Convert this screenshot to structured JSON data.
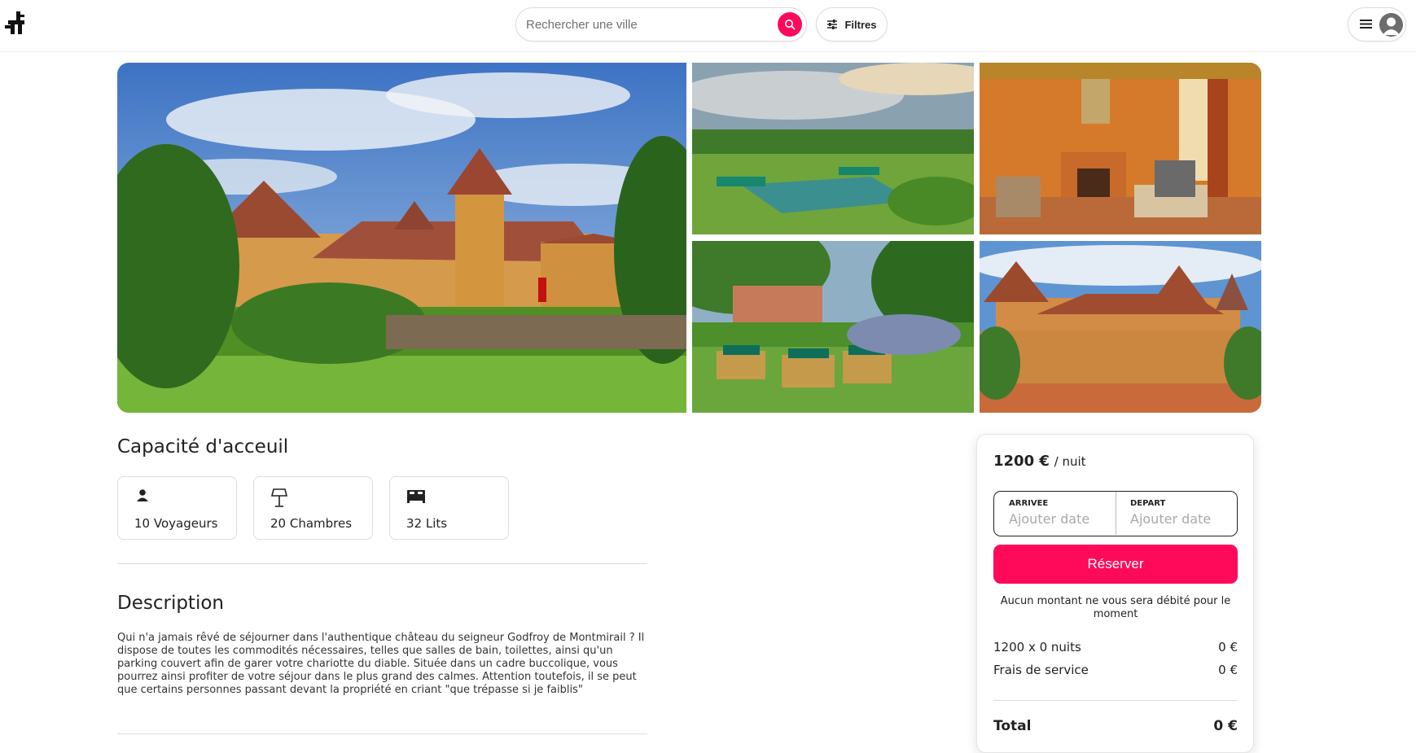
{
  "header": {
    "search_placeholder": "Rechercher une ville",
    "filters_label": "Filtres"
  },
  "gallery": {
    "photos": [
      "castle-exterior",
      "garden-pool",
      "living-room",
      "garden-terrace",
      "castle-courtyard"
    ]
  },
  "capacity": {
    "title": "Capacité d'acceuil",
    "items": [
      {
        "icon": "person-icon",
        "label": "10 Voyageurs"
      },
      {
        "icon": "lamp-icon",
        "label": "20 Chambres"
      },
      {
        "icon": "bed-icon",
        "label": "32 Lits"
      }
    ]
  },
  "description": {
    "title": "Description",
    "text": "Qui n'a jamais rêvé de séjourner dans l'authentique château du seigneur Godfroy de Montmirail ? Il dispose de toutes les commodités nécessaires, telles que salles de bain, toilettes, ainsi qu'un parking couvert afin de garer votre chariotte du diable. Située dans un cadre buccolique, vous pourrez ainsi profiter de votre séjour dans le plus grand des calmes. Attention toutefois, il se peut que certains personnes passant devant la propriété en criant \"que trépasse si je faiblis\""
  },
  "booking": {
    "price": "1200 €",
    "per_night": "/ nuit",
    "arrival_label": "ARRIVEE",
    "arrival_value": "Ajouter date",
    "departure_label": "DEPART",
    "departure_value": "Ajouter date",
    "reserve_label": "Réserver",
    "note": "Aucun montant ne vous sera débité pour le moment",
    "lines": [
      {
        "label": "1200 x 0 nuits",
        "value": "0 €"
      },
      {
        "label": "Frais de service",
        "value": "0 €"
      }
    ],
    "total_label": "Total",
    "total_value": "0 €"
  },
  "colors": {
    "accent": "#ff0a5a",
    "border": "#dcdcdc"
  }
}
